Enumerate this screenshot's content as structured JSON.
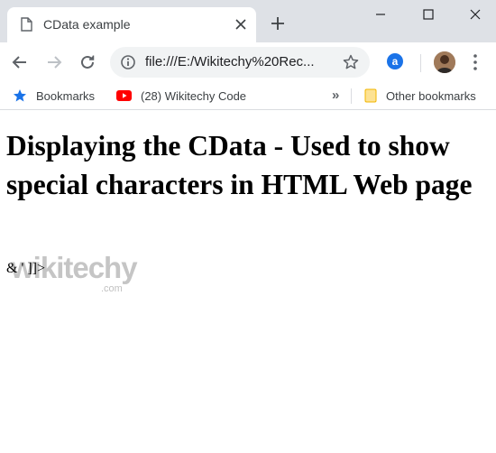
{
  "tab": {
    "title": "CData example",
    "page_icon": "page-icon",
    "close_icon": "close-icon"
  },
  "toolbar": {
    "url": "file:///E:/Wikitechy%20Rec...",
    "extension_label": "a"
  },
  "bookmarks": {
    "items": [
      {
        "label": "Bookmarks",
        "icon": "star-icon"
      },
      {
        "label": "(28) Wikitechy Code",
        "icon": "youtube-icon"
      }
    ],
    "other_label": "Other bookmarks",
    "overflow_label": "»"
  },
  "page": {
    "heading": "Displaying the CData - Used to show special characters in HTML Web page",
    "text": "& ' ]]>"
  },
  "watermark": {
    "brand": "wikitechy",
    "domain": ".com"
  },
  "colors": {
    "tabstrip": "#dee1e6",
    "omnibox": "#f1f3f4",
    "accent": "#1a73e8",
    "youtube": "#ff0000",
    "folder": "#fbc02d"
  }
}
